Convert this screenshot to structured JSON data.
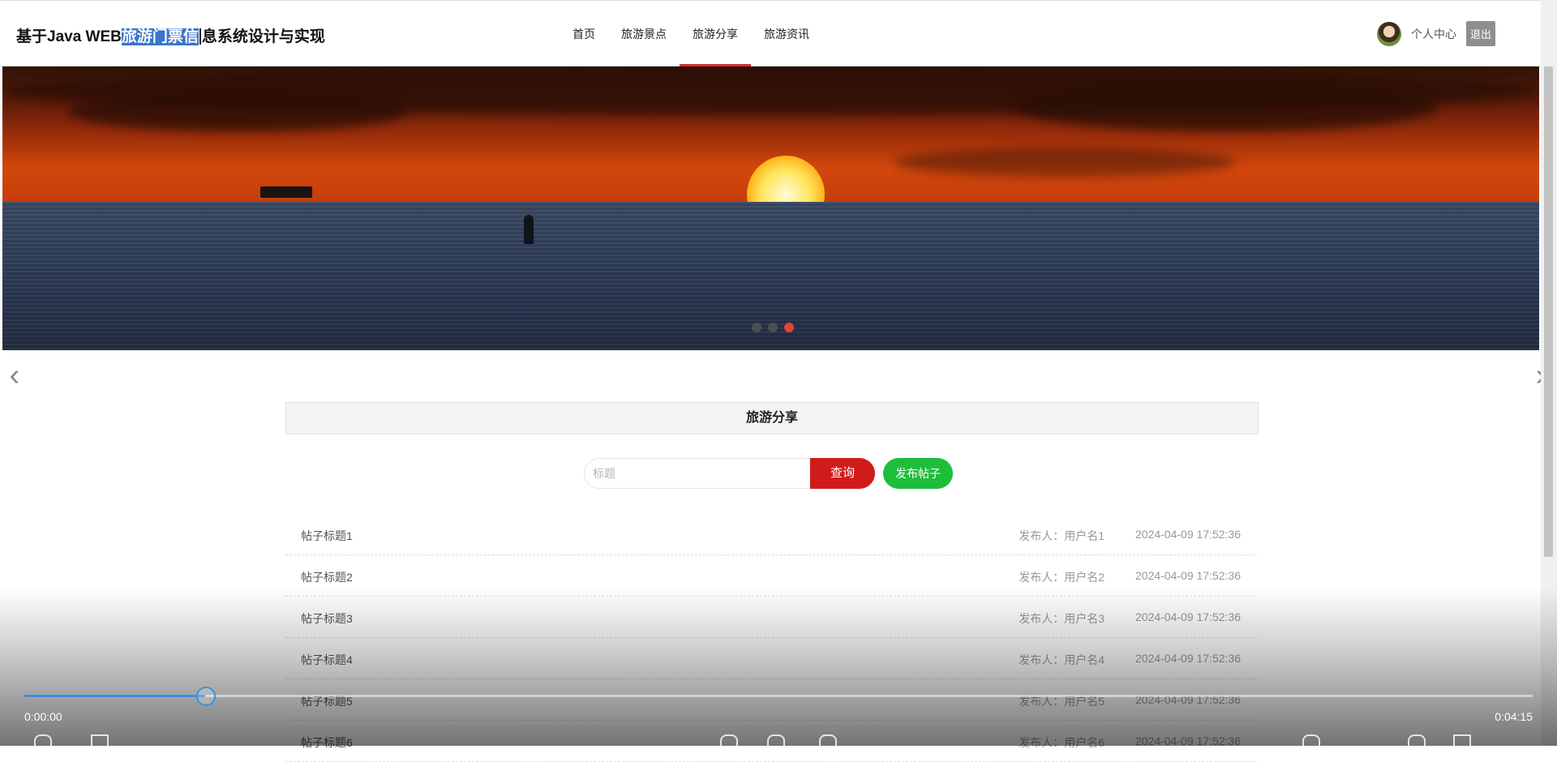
{
  "header": {
    "title_prefix": "基于Java WEB",
    "title_selected": "旅游门票信",
    "title_suffix": "息系统设计与实现",
    "nav": [
      "首页",
      "旅游景点",
      "旅游分享",
      "旅游资讯"
    ],
    "active_nav": "旅游分享",
    "user_center": "个人中心",
    "logout": "退出"
  },
  "banner": {
    "slide_count": 3,
    "active_slide": 3
  },
  "section": {
    "title": "旅游分享",
    "search_placeholder": "标题",
    "search_button": "查询",
    "post_button": "发布帖子"
  },
  "posts": [
    {
      "title": "帖子标题1",
      "author": "发布人：用户名1",
      "time": "2024-04-09 17:52:36"
    },
    {
      "title": "帖子标题2",
      "author": "发布人：用户名2",
      "time": "2024-04-09 17:52:36"
    },
    {
      "title": "帖子标题3",
      "author": "发布人：用户名3",
      "time": "2024-04-09 17:52:36"
    },
    {
      "title": "帖子标题4",
      "author": "发布人：用户名4",
      "time": "2024-04-09 17:52:36"
    },
    {
      "title": "帖子标题5",
      "author": "发布人：用户名5",
      "time": "2024-04-09 17:52:36"
    },
    {
      "title": "帖子标题6",
      "author": "发布人：用户名6",
      "time": "2024-04-09 17:52:36"
    }
  ],
  "video": {
    "current_time": "0:00:00",
    "total_time": "0:04:15",
    "progress_fraction": 0.12
  },
  "colors": {
    "accent_red": "#d11b1b",
    "post_green": "#1ebe3a",
    "progress_blue": "#3d8fe0",
    "active_dot": "#e0443c"
  }
}
